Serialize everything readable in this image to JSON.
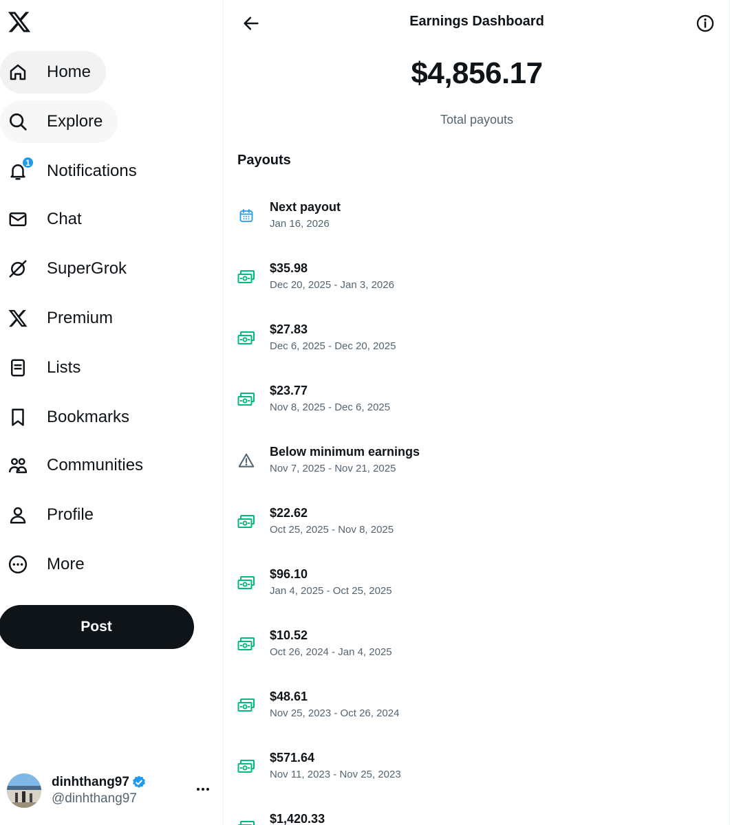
{
  "sidebar": {
    "items": [
      {
        "label": "Home",
        "icon": "home-icon"
      },
      {
        "label": "Explore",
        "icon": "search-icon"
      },
      {
        "label": "Notifications",
        "icon": "bell-icon",
        "badge": "1"
      },
      {
        "label": "Chat",
        "icon": "envelope-icon"
      },
      {
        "label": "SuperGrok",
        "icon": "grok-icon"
      },
      {
        "label": "Premium",
        "icon": "x-logo-icon"
      },
      {
        "label": "Lists",
        "icon": "list-icon"
      },
      {
        "label": "Bookmarks",
        "icon": "bookmark-icon"
      },
      {
        "label": "Communities",
        "icon": "communities-icon"
      },
      {
        "label": "Profile",
        "icon": "person-icon"
      },
      {
        "label": "More",
        "icon": "more-circle-icon"
      }
    ],
    "post_label": "Post",
    "account": {
      "display_name": "dinhthang97",
      "handle": "@dinhthang97"
    }
  },
  "main": {
    "title": "Earnings Dashboard",
    "total_amount": "$4,856.17",
    "total_label": "Total payouts",
    "section_title": "Payouts",
    "payouts": [
      {
        "amount": "Next payout",
        "dates": "Jan 16, 2026",
        "icon": "calendar-icon"
      },
      {
        "amount": "$35.98",
        "dates": "Dec 20, 2025 - Jan 3, 2026",
        "icon": "money-icon"
      },
      {
        "amount": "$27.83",
        "dates": "Dec 6, 2025 - Dec 20, 2025",
        "icon": "money-icon"
      },
      {
        "amount": "$23.77",
        "dates": "Nov 8, 2025 - Dec 6, 2025",
        "icon": "money-icon"
      },
      {
        "amount": "Below minimum earnings",
        "dates": "Nov 7, 2025 - Nov 21, 2025",
        "icon": "warning-icon"
      },
      {
        "amount": "$22.62",
        "dates": "Oct 25, 2025 - Nov 8, 2025",
        "icon": "money-icon"
      },
      {
        "amount": "$96.10",
        "dates": "Jan 4, 2025 - Oct 25, 2025",
        "icon": "money-icon"
      },
      {
        "amount": "$10.52",
        "dates": "Oct 26, 2024 - Jan 4, 2025",
        "icon": "money-icon"
      },
      {
        "amount": "$48.61",
        "dates": "Nov 25, 2023 - Oct 26, 2024",
        "icon": "money-icon"
      },
      {
        "amount": "$571.64",
        "dates": "Nov 11, 2023 - Nov 25, 2023",
        "icon": "money-icon"
      },
      {
        "amount": "$1,420.33",
        "dates": "",
        "icon": "money-icon"
      }
    ]
  },
  "colors": {
    "accent": "#1d9bf0",
    "money_green": "#00ba7c",
    "text_primary": "#0f1419",
    "text_secondary": "#536471",
    "calendar_blue": "#1d9bf0"
  }
}
